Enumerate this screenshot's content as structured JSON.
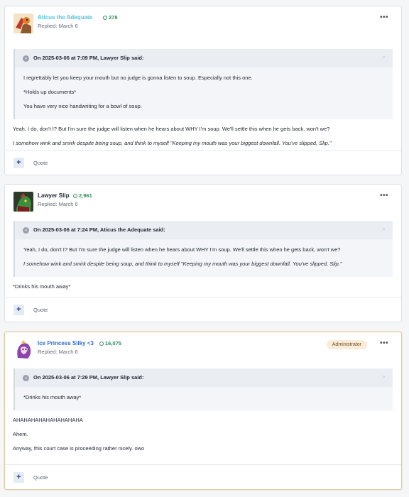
{
  "posts": [
    {
      "author": "Aticus the Adequate",
      "author_color": "#4fc3d9",
      "reputation": "278",
      "replied": "Replied: March 6",
      "more": "•••",
      "quote_header": "On 2025-03-06 at 7:09 PM, Lawyer Slip said:",
      "quote_lines": [
        "I regrettably let you keep your mouth but no judge is gonna listen to soup. Especially not this one.",
        "*Holds up documents*",
        "You have very nice handwriting for a bowl of soup."
      ],
      "body_lines": [
        "Yeah, I do, don't I? But I'm sure the judge will listen when he hears about WHY I'm soup. We'll settle this when he gets back, won't we?",
        "I somehow wink and smirk despite being soup, and think to myself \"Keeping my mouth was your biggest downfall. You've slipped, Slip.\""
      ],
      "plus": "+",
      "quote_label": "Quote"
    },
    {
      "author": "Lawyer Slip",
      "author_color": "#1f2430",
      "reputation": "2,961",
      "replied": "Replied: March 6",
      "more": "•••",
      "quote_header": "On 2025-03-06 at 7:24 PM, Aticus the Adequate said:",
      "quote_lines": [
        "Yeah, I do, don't I? But I'm sure the judge will listen when he hears about WHY I'm soup. We'll settle this when he gets back, won't we?",
        "I somehow wink and smirk despite being soup, and think to myself \"Keeping my mouth was your biggest downfall. You've slipped, Slip.\""
      ],
      "body_lines": [
        "*Drinks his mouth away*"
      ],
      "plus": "+",
      "quote_label": "Quote"
    },
    {
      "author": "Ice Princess Silky <3",
      "author_color": "#2c6fc9",
      "reputation": "16,075",
      "replied": "Replied: March 6",
      "badge": "Administrator",
      "more": "•••",
      "quote_header": "On 2025-03-06 at 7:29 PM, Lawyer Slip said:",
      "quote_lines": [
        "*Drinks his mouth away*"
      ],
      "body_lines": [
        "AHAHAHAHAHAHAHAHAHA",
        "Ahem.",
        "Anyway, this court case is proceeding rather nicely. owo"
      ],
      "plus": "+",
      "quote_label": "Quote"
    }
  ],
  "icons": {
    "reputation": "reputation-icon",
    "collapse": "chevron-down-icon",
    "share": "share-icon",
    "more": "ellipsis-icon",
    "plus": "plus-icon"
  }
}
